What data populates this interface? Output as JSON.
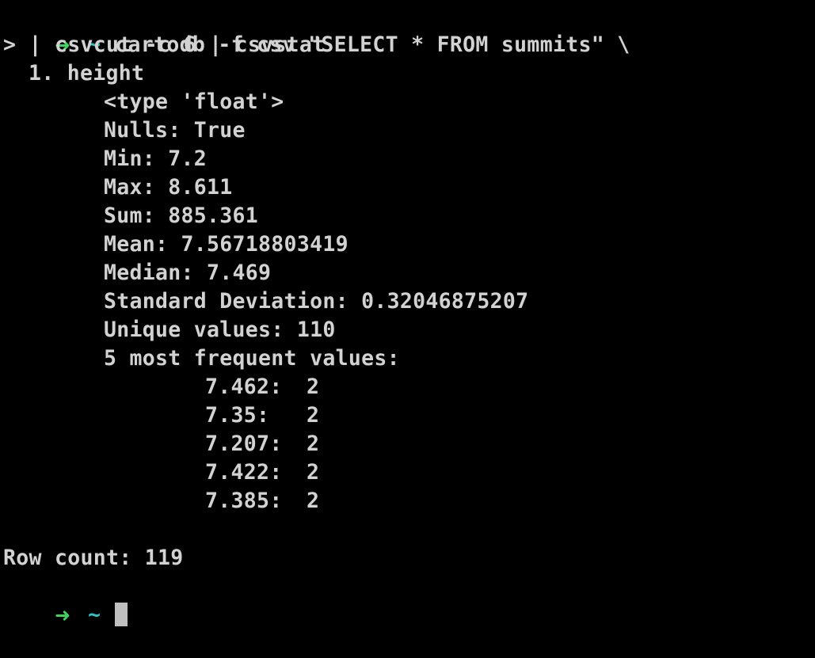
{
  "terminal": {
    "prompt_symbol": "➜",
    "prompt_dir": "~",
    "command_line_1": "cartodb -f csv \"SELECT * FROM summits\" \\",
    "command_line_2": "> | csvcut -c 6 | csvstat",
    "column_header": "1. height",
    "stats": {
      "type": "<type 'float'>",
      "nulls": "Nulls: True",
      "min": "Min: 7.2",
      "max": "Max: 8.611",
      "sum": "Sum: 885.361",
      "mean": "Mean: 7.56718803419",
      "median": "Median: 7.469",
      "stddev": "Standard Deviation: 0.32046875207",
      "unique": "Unique values: 110",
      "frequent_header": "5 most frequent values:"
    },
    "frequent": [
      {
        "value": "7.462:",
        "count": "2"
      },
      {
        "value": "7.35:",
        "count": "2"
      },
      {
        "value": "7.207:",
        "count": "2"
      },
      {
        "value": "7.422:",
        "count": "2"
      },
      {
        "value": "7.385:",
        "count": "2"
      }
    ],
    "row_count": "Row count: 119",
    "colors": {
      "background": "#000000",
      "text": "#d2d2d2",
      "arrow": "#3fd35b",
      "tilde": "#2fc4c8",
      "cursor": "#bfbfbf"
    }
  }
}
